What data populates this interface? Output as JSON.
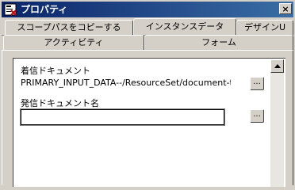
{
  "window": {
    "title": "プロパティ",
    "close_label": "×",
    "app_icon": "properties-app-icon"
  },
  "tabs_row1": [
    {
      "label": "スコープパスをコピーする",
      "active": false
    },
    {
      "label": "インスタンスデータ",
      "active": true
    },
    {
      "label": "デザインU",
      "active": false
    }
  ],
  "tabs_row2": [
    {
      "label": "アクティビティ",
      "active": false
    },
    {
      "label": "フォーム",
      "active": false
    }
  ],
  "form": {
    "incoming_doc_label": "着信ドキュメント",
    "incoming_doc_value": "PRIMARY_INPUT_DATA--/ResourceSet/document-t...",
    "outgoing_doc_label": "発信ドキュメント名",
    "outgoing_doc_value": "",
    "browse_label": "..."
  },
  "icons": {
    "scroll_up": "scroll-up-arrow-icon"
  }
}
